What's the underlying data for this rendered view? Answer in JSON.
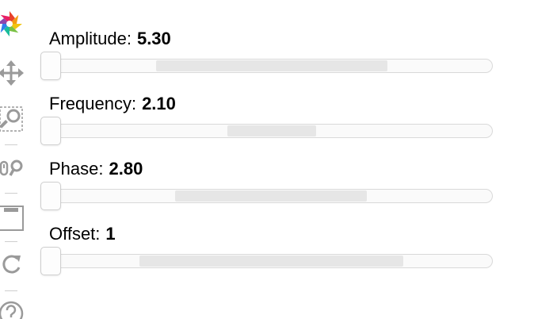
{
  "toolbar": {
    "tools": [
      {
        "name": "logo",
        "icon": "bokeh-logo-icon"
      },
      {
        "name": "pan",
        "icon": "pan-move-icon"
      },
      {
        "name": "box-zoom",
        "icon": "box-zoom-icon"
      },
      {
        "name": "wheel-zoom",
        "icon": "wheel-zoom-icon"
      },
      {
        "name": "save",
        "icon": "save-icon"
      },
      {
        "name": "reset",
        "icon": "reset-icon"
      },
      {
        "name": "help",
        "icon": "help-icon"
      }
    ]
  },
  "sliders": [
    {
      "label": "Amplitude:",
      "value": "5.30"
    },
    {
      "label": "Frequency:",
      "value": "2.10"
    },
    {
      "label": "Phase:",
      "value": "2.80"
    },
    {
      "label": "Offset:",
      "value": "1"
    }
  ],
  "colors": {
    "track_border": "#d9d9d9",
    "track_fill": "#fafafa",
    "range_fill": "#e6e6e6",
    "icon_gray": "#9a9a9a"
  }
}
